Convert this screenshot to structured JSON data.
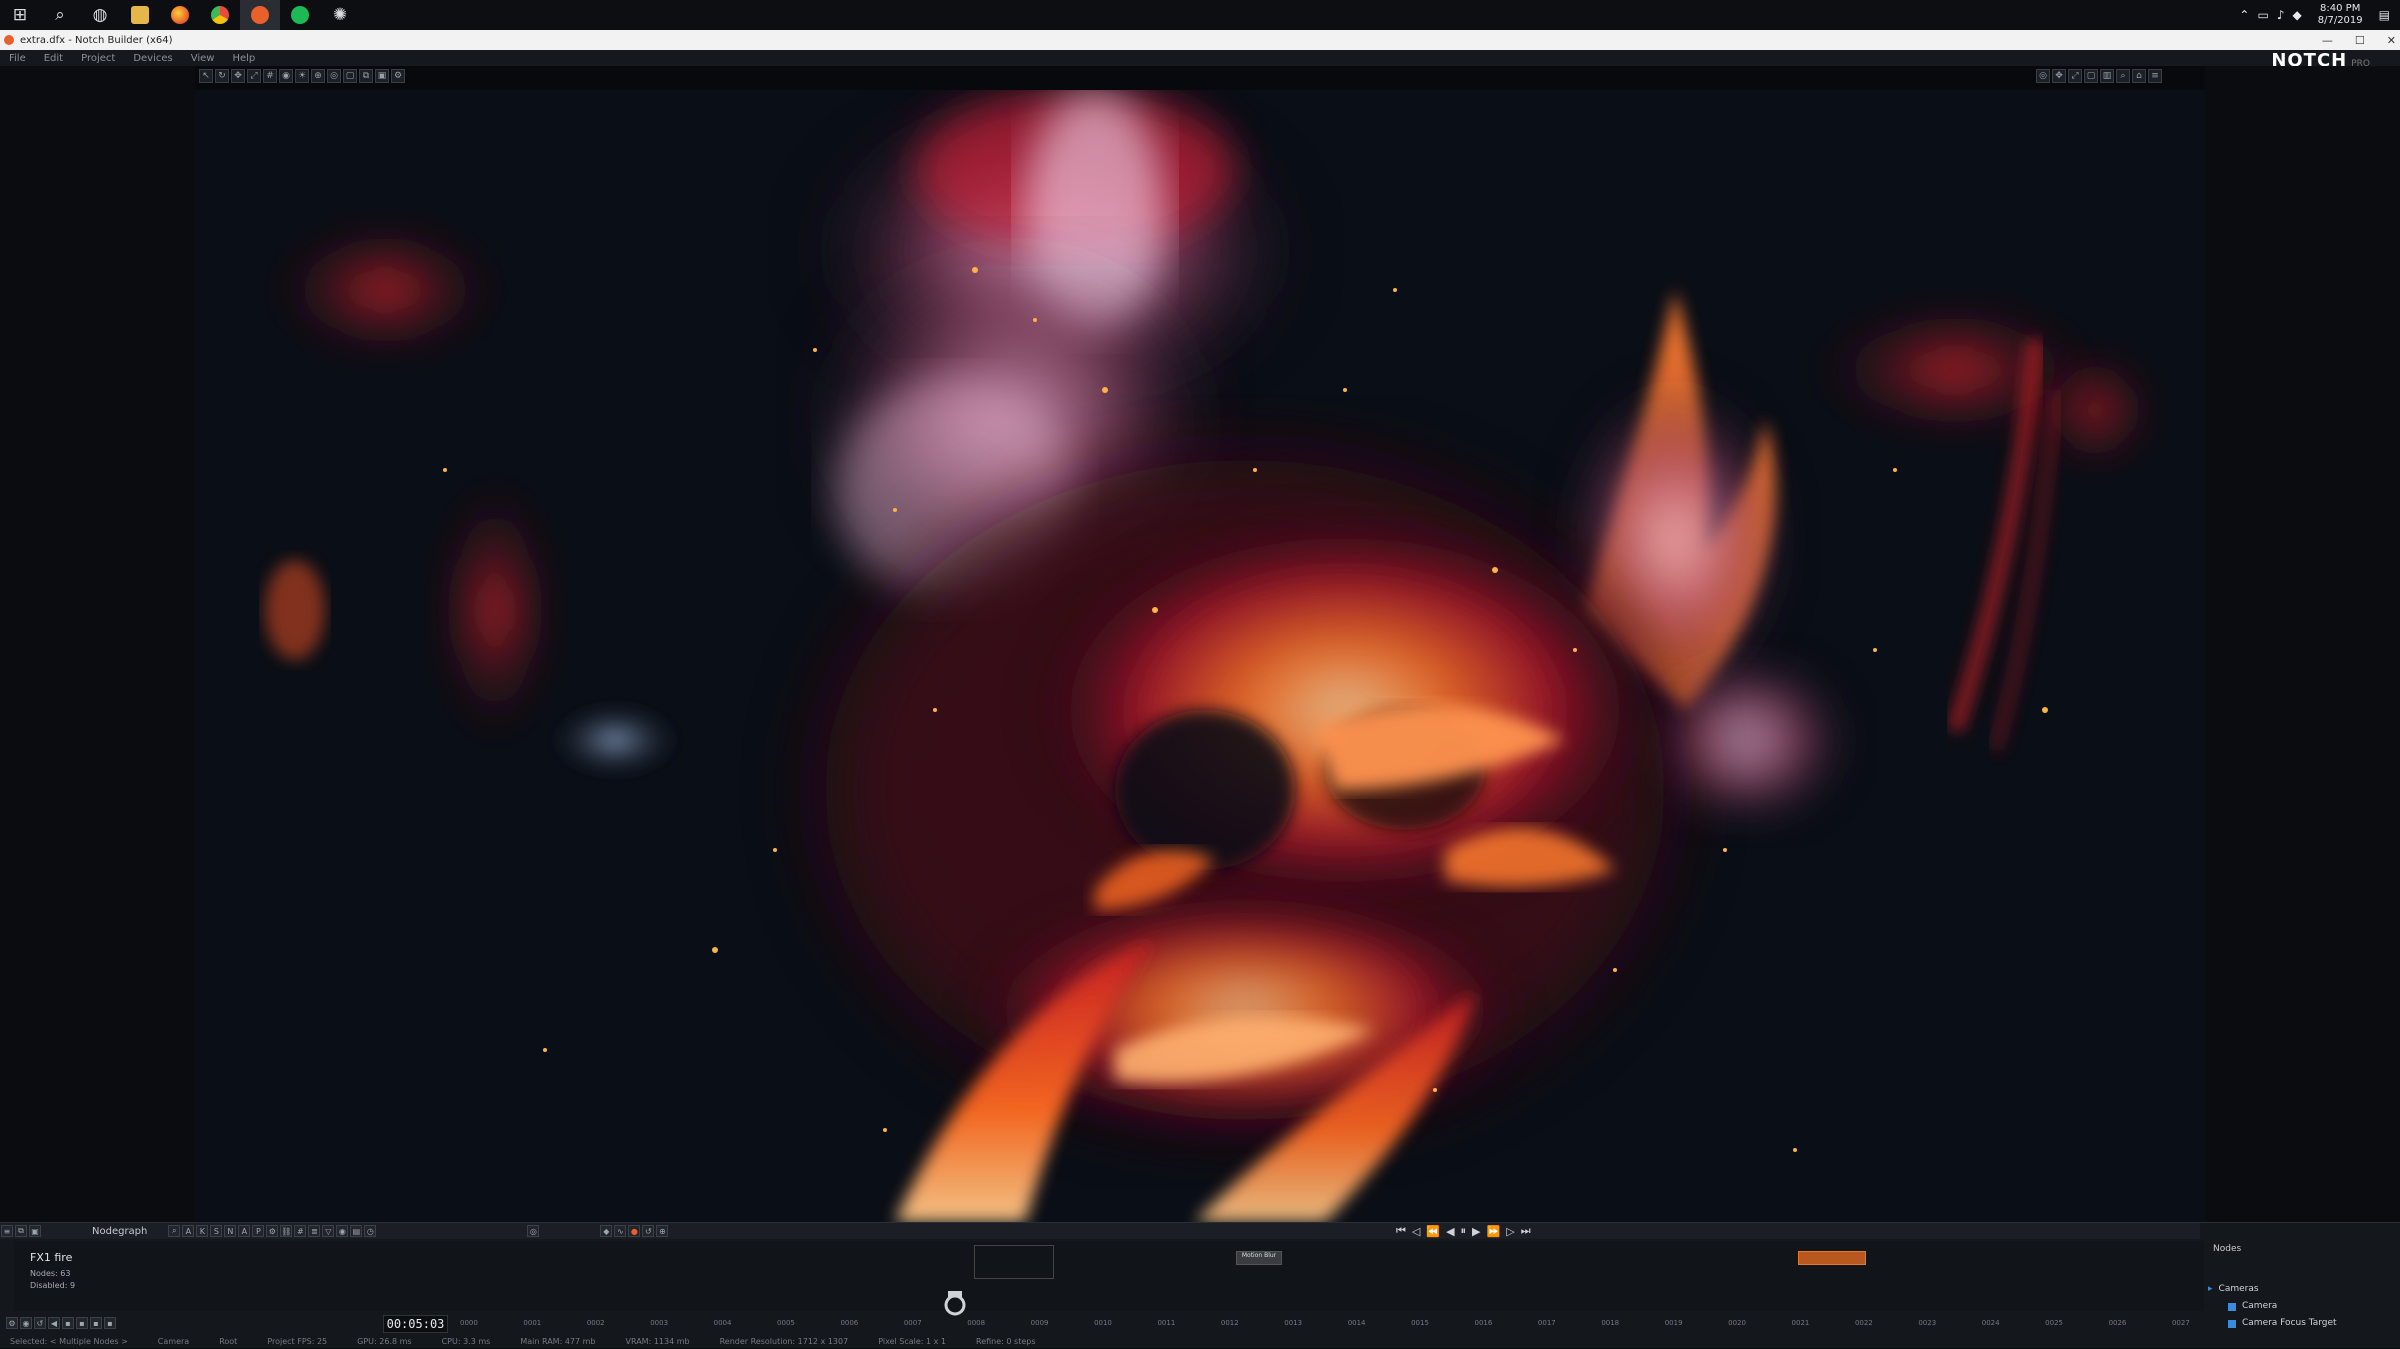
{
  "taskbar": {
    "icons": [
      "windows-start-icon",
      "search-icon",
      "game-icon",
      "file-explorer-icon",
      "firefox-icon",
      "chrome-icon",
      "notch-app-icon",
      "spotify-icon",
      "other-app-icon"
    ],
    "clock_time": "8:40 PM",
    "clock_date": "8/7/2019"
  },
  "window": {
    "title": "extra.dfx - Notch Builder (x64)"
  },
  "menu": [
    "File",
    "Edit",
    "Project",
    "Devices",
    "View",
    "Help"
  ],
  "logo": {
    "brand": "NOTCH",
    "tier": "PRO"
  },
  "nodegraph": {
    "title": "Nodegraph",
    "tool_letters": [
      "A",
      "K",
      "S",
      "N",
      "A",
      "P"
    ],
    "selected_node": "FX1  fire",
    "nodes_label": "Nodes: 63",
    "disabled_label": "Disabled: 9",
    "node_box_1": "Motion Blur"
  },
  "timeline": {
    "timecode": "00:05:03",
    "ticks": [
      "0000",
      "0001",
      "0002",
      "0003",
      "0004",
      "0005",
      "0006",
      "0007",
      "0008",
      "0009",
      "0010",
      "0011",
      "0012",
      "0013",
      "0014",
      "0015",
      "0016",
      "0017",
      "0018",
      "0019",
      "0020",
      "0021",
      "0022",
      "0023",
      "0024",
      "0025",
      "0026",
      "0027"
    ]
  },
  "status": {
    "items": [
      "Selected: < Multiple Nodes >",
      "Camera",
      "Root",
      "Project FPS: 25",
      "GPU: 26.8 ms",
      "CPU: 3.3 ms",
      "Main RAM: 477 mb",
      "VRAM: 1134 mb",
      "Render Resolution: 1712 x 1307",
      "Pixel Scale: 1 x 1",
      "Refine: 0 steps"
    ]
  },
  "nodes_panel": {
    "tab": "Nodes",
    "group": "Cameras",
    "items": [
      "Camera",
      "Camera Focus Target"
    ]
  },
  "colors": {
    "accent": "#e8602c",
    "viewport_bg": "#0a0e16"
  }
}
